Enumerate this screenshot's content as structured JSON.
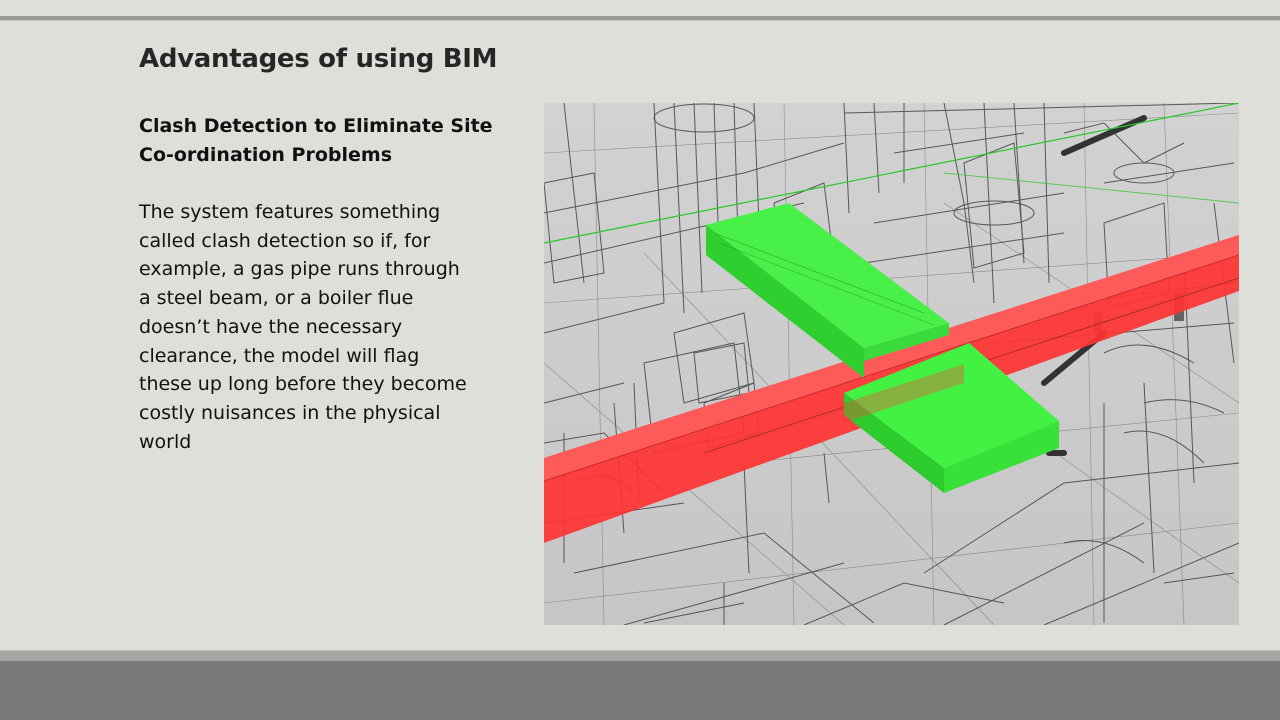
{
  "slide": {
    "title": "Advantages of using BIM",
    "subtitle_lines": [
      "Clash Detection to Eliminate Site",
      "Co-ordination Problems"
    ],
    "body_lines": [
      "The system features something",
      "called clash detection so if, for",
      "example, a gas pipe runs through",
      "a steel beam, or a boiler flue",
      "doesn’t have the necessary",
      "clearance, the model will flag",
      "these up long before they become",
      "costly nuisances in the physical",
      "world"
    ]
  },
  "figure": {
    "description_icon": "bim-clash-wireframe-icon",
    "colors": {
      "clash_red": "#ff3b3b",
      "clash_green": "#3be33b",
      "wireframe": "#3a3a3a",
      "background": "#cfcfcf"
    }
  }
}
